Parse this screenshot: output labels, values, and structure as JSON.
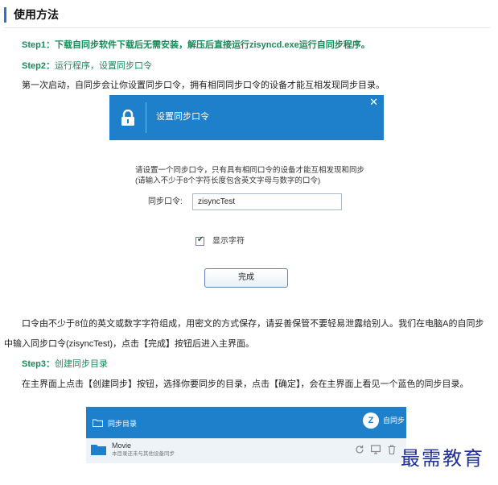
{
  "section": {
    "title": "使用方法"
  },
  "step1": {
    "text": "Step1：下载自同步软件下载后无需安装，解压后直接运行zisyncd.exe运行自同步程序。"
  },
  "step2": {
    "label": "Step2：",
    "text": "运行程序，设置同步口令"
  },
  "para1": "第一次启动，自同步会让你设置同步口令，拥有相同同步口令的设备才能互相发现同步目录。",
  "dialog": {
    "title": "设置同步口令",
    "close": "✕",
    "instruction": "请设置一个同步口令，只有具有相同口令的设备才能互相发现和同步",
    "hint": "(请输入不少于8个字符长度包含英文字母与数字的口令)",
    "password_label": "同步口令:",
    "password_value": "zisyncTest",
    "show_chars_label": "显示字符",
    "show_chars_checked": true,
    "done_button": "完成"
  },
  "para2_line1": "口令由不少于8位的英文或数字字符组成，用密文的方式保存，请妥善保管不要轻易泄露给别人。我们在电脑A的自同步",
  "para2_line2": "中输入同步口令(zisyncTest)，点击【完成】按钮后进入主界面。",
  "step3": {
    "label": "Step3：",
    "text": "创建同步目录"
  },
  "para3": "在主界面上点击【创建同步】按钮，选择你要同步的目录，点击【确定】，会在主界面上看见一个蓝色的同步目录。",
  "main_window": {
    "tab_label": "同步目录",
    "logo_letter": "Z",
    "brand": "自同步",
    "folder_name": "Movie",
    "folder_desc": "本目录还未与其他设备同步"
  },
  "watermark": "最需教育",
  "colors": {
    "accent": "#1e7fcb",
    "step_green": "#1a8a5a",
    "watermark": "#1f2f97"
  },
  "icons": [
    "lock-icon",
    "folder-icon",
    "sync-icon",
    "monitor-icon",
    "trash-icon"
  ]
}
